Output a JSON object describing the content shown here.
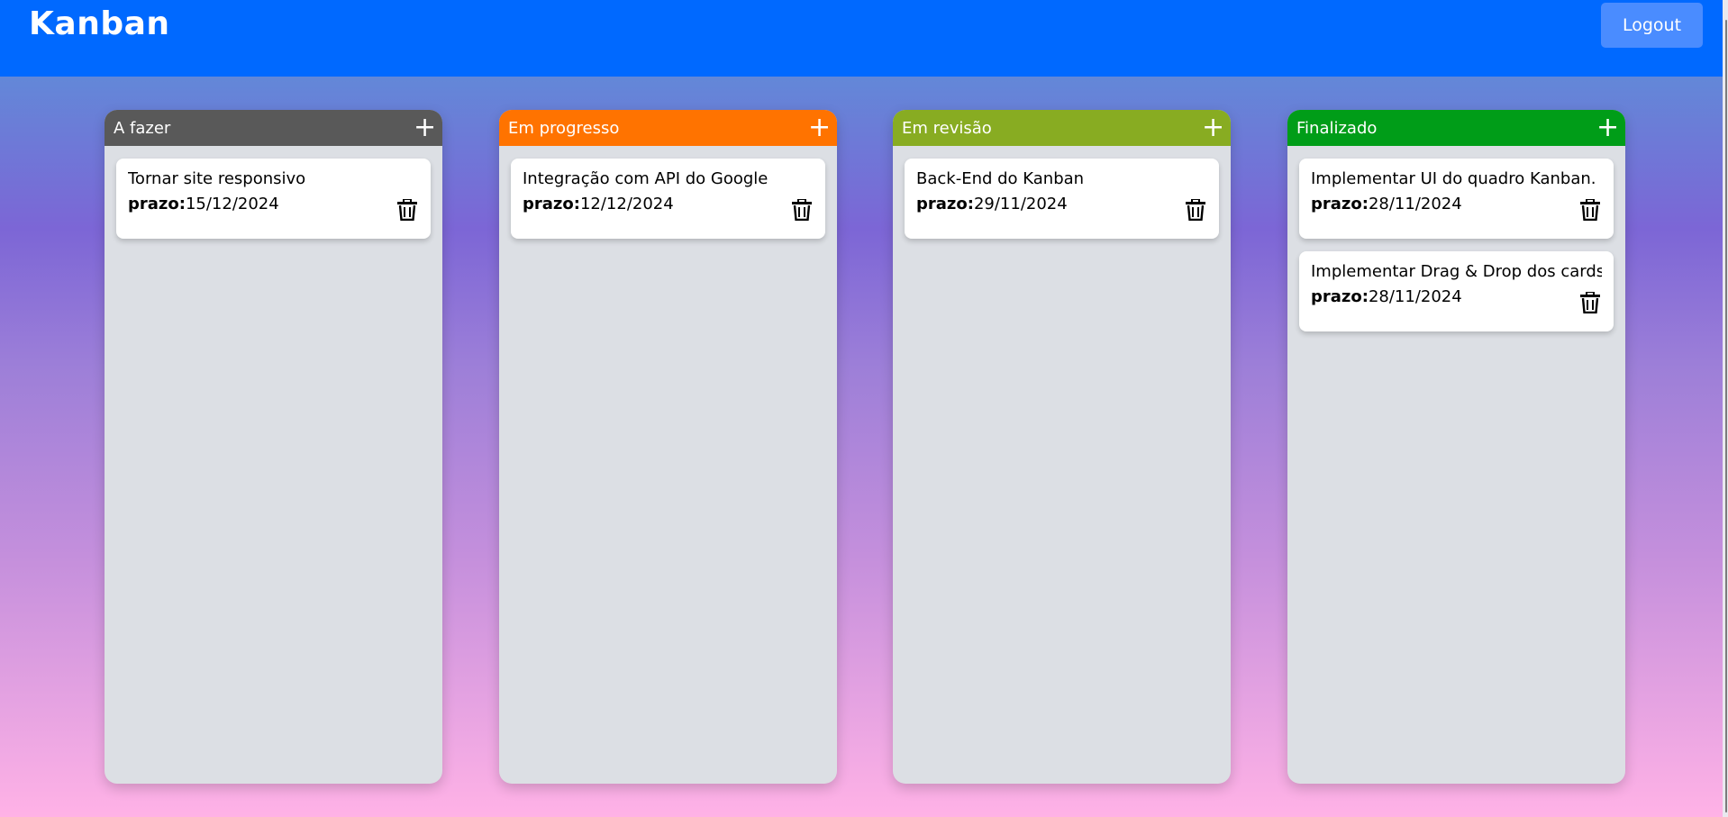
{
  "header": {
    "title": "Kanban",
    "logout_label": "Logout"
  },
  "colors": {
    "topbar": "#0069ff",
    "todo": "#595959",
    "progress": "#ff7300",
    "review": "#88ac22",
    "done": "#009d18"
  },
  "columns": [
    {
      "title": "A fazer",
      "add_icon": "plus-icon",
      "cards": [
        {
          "title": "Tornar site responsivo",
          "due_label": "prazo:",
          "due_date": "15/12/2024"
        }
      ]
    },
    {
      "title": "Em progresso",
      "add_icon": "plus-icon",
      "cards": [
        {
          "title": "Integração com API do Google",
          "due_label": "prazo:",
          "due_date": "12/12/2024"
        }
      ]
    },
    {
      "title": "Em revisão",
      "add_icon": "plus-icon",
      "cards": [
        {
          "title": "Back-End do Kanban",
          "due_label": "prazo:",
          "due_date": "29/11/2024"
        }
      ]
    },
    {
      "title": "Finalizado",
      "add_icon": "plus-icon",
      "cards": [
        {
          "title": "Implementar UI do quadro Kanban.",
          "due_label": "prazo:",
          "due_date": "28/11/2024"
        },
        {
          "title": "Implementar Drag & Drop dos cards",
          "due_label": "prazo:",
          "due_date": "28/11/2024"
        }
      ]
    }
  ]
}
